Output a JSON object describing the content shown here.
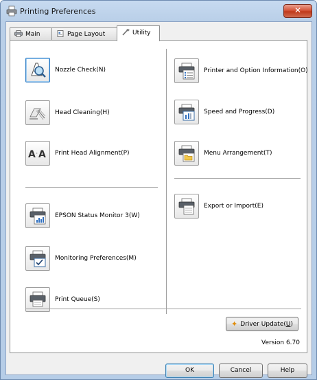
{
  "window": {
    "title": "Printing Preferences",
    "close_label": "✕"
  },
  "tabs": [
    {
      "label": "Main",
      "icon": "printer-tab-icon"
    },
    {
      "label": "Page Layout",
      "icon": "page-layout-tab-icon"
    },
    {
      "label": "Utility",
      "icon": "wrench-tab-icon",
      "active": true
    }
  ],
  "utility": {
    "left": [
      {
        "label": "Nozzle Check(N)",
        "icon": "nozzle-check-icon"
      },
      {
        "label": "Head Cleaning(H)",
        "icon": "head-cleaning-icon"
      },
      {
        "label": "Print Head Alignment(P)",
        "icon": "print-head-alignment-icon"
      },
      {
        "label": "EPSON Status Monitor 3(W)",
        "icon": "status-monitor-icon"
      },
      {
        "label": "Monitoring Preferences(M)",
        "icon": "monitoring-preferences-icon"
      },
      {
        "label": "Print Queue(S)",
        "icon": "print-queue-icon"
      }
    ],
    "right": [
      {
        "label": "Printer and Option Information(O)",
        "icon": "printer-info-icon"
      },
      {
        "label": "Speed and Progress(D)",
        "icon": "speed-progress-icon"
      },
      {
        "label": "Menu Arrangement(T)",
        "icon": "menu-arrangement-icon"
      },
      {
        "label": "Export or Import(E)",
        "icon": "export-import-icon"
      }
    ],
    "driver_update_text": "Driver Update(",
    "driver_update_key": "U",
    "driver_update_end": ")",
    "version": "Version 6.70"
  },
  "buttons": {
    "ok": "OK",
    "cancel": "Cancel",
    "help": "Help"
  },
  "colors": {
    "title_bar": "#b9cfe8",
    "close_button": "#c7432a",
    "focus_ring": "#2e7bc4"
  }
}
